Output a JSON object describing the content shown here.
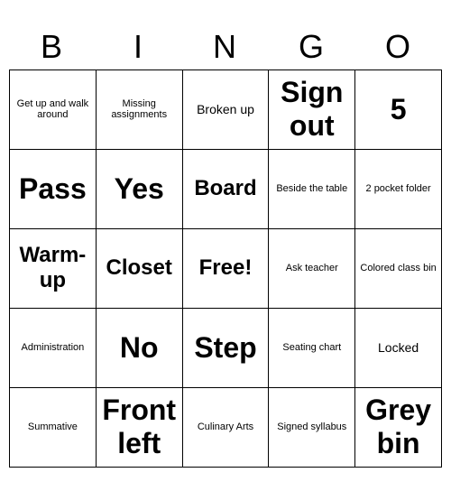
{
  "header": {
    "letters": [
      "B",
      "I",
      "N",
      "G",
      "O"
    ]
  },
  "cells": [
    {
      "text": "Get up and walk around",
      "size": "small"
    },
    {
      "text": "Missing assignments",
      "size": "small"
    },
    {
      "text": "Broken up",
      "size": "medium"
    },
    {
      "text": "Sign out",
      "size": "xlarge"
    },
    {
      "text": "5",
      "size": "xlarge"
    },
    {
      "text": "Pass",
      "size": "xlarge"
    },
    {
      "text": "Yes",
      "size": "xlarge"
    },
    {
      "text": "Board",
      "size": "large"
    },
    {
      "text": "Beside the table",
      "size": "small"
    },
    {
      "text": "2 pocket folder",
      "size": "small"
    },
    {
      "text": "Warm-up",
      "size": "large"
    },
    {
      "text": "Closet",
      "size": "large"
    },
    {
      "text": "Free!",
      "size": "large"
    },
    {
      "text": "Ask teacher",
      "size": "small"
    },
    {
      "text": "Colored class bin",
      "size": "small"
    },
    {
      "text": "Administration",
      "size": "small"
    },
    {
      "text": "No",
      "size": "xlarge"
    },
    {
      "text": "Step",
      "size": "xlarge"
    },
    {
      "text": "Seating chart",
      "size": "small"
    },
    {
      "text": "Locked",
      "size": "medium"
    },
    {
      "text": "Summative",
      "size": "small"
    },
    {
      "text": "Front left",
      "size": "xlarge"
    },
    {
      "text": "Culinary Arts",
      "size": "small"
    },
    {
      "text": "Signed syllabus",
      "size": "small"
    },
    {
      "text": "Grey bin",
      "size": "xlarge"
    }
  ]
}
